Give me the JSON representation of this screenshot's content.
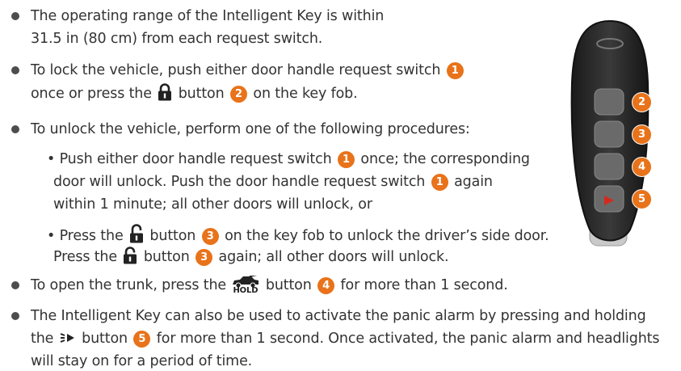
{
  "items": [
    {
      "lines": [
        "The operating range of the Intelligent Key is within",
        "31.5 in (80 cm) from each request switch."
      ]
    },
    {
      "l1_pre": "To lock the vehicle, push either door handle request switch",
      "l1_num": "1",
      "l2_pre": "once or press the",
      "l2_mid": "button",
      "l2_num": "2",
      "l2_post": "on the key fob."
    },
    {
      "line": "To unlock the vehicle, perform one of the following procedures:"
    },
    {
      "a1_pre": "• Push either door handle request switch",
      "a1_num": "1",
      "a1_post": "once; the corresponding",
      "a2_pre": "door will unlock. Push the door handle request switch",
      "a2_num": "1",
      "a2_post": "again",
      "a3": "within 1 minute; all other doors will unlock, or"
    },
    {
      "b1_pre": "• Press the",
      "b1_mid": "button",
      "b1_num": "3",
      "b1_post": "on the key fob to unlock the driver’s side door.",
      "b2_pre": "Press the",
      "b2_mid": "button",
      "b2_num": "3",
      "b2_post": "again; all other doors will unlock."
    },
    {
      "pre": "To open the trunk, press the",
      "mid": "button",
      "num": "4",
      "post": "for more than 1 second.",
      "hold": "HOLD"
    },
    {
      "l1": "The Intelligent Key can also be used to activate the panic alarm by pressing and holding",
      "l2_pre": "the",
      "l2_mid": "button",
      "l2_num": "5",
      "l2_post": "for more than 1 second. Once activated, the panic alarm and headlights",
      "l3": "will stay on for a period of time."
    }
  ],
  "key_fob": {
    "button_numbers": [
      "2",
      "3",
      "4",
      "5"
    ]
  },
  "colors": {
    "callout": "#e8731a",
    "text": "#333333",
    "fob_body": "#2a2a2a",
    "fob_button": "#6a6a6a"
  }
}
